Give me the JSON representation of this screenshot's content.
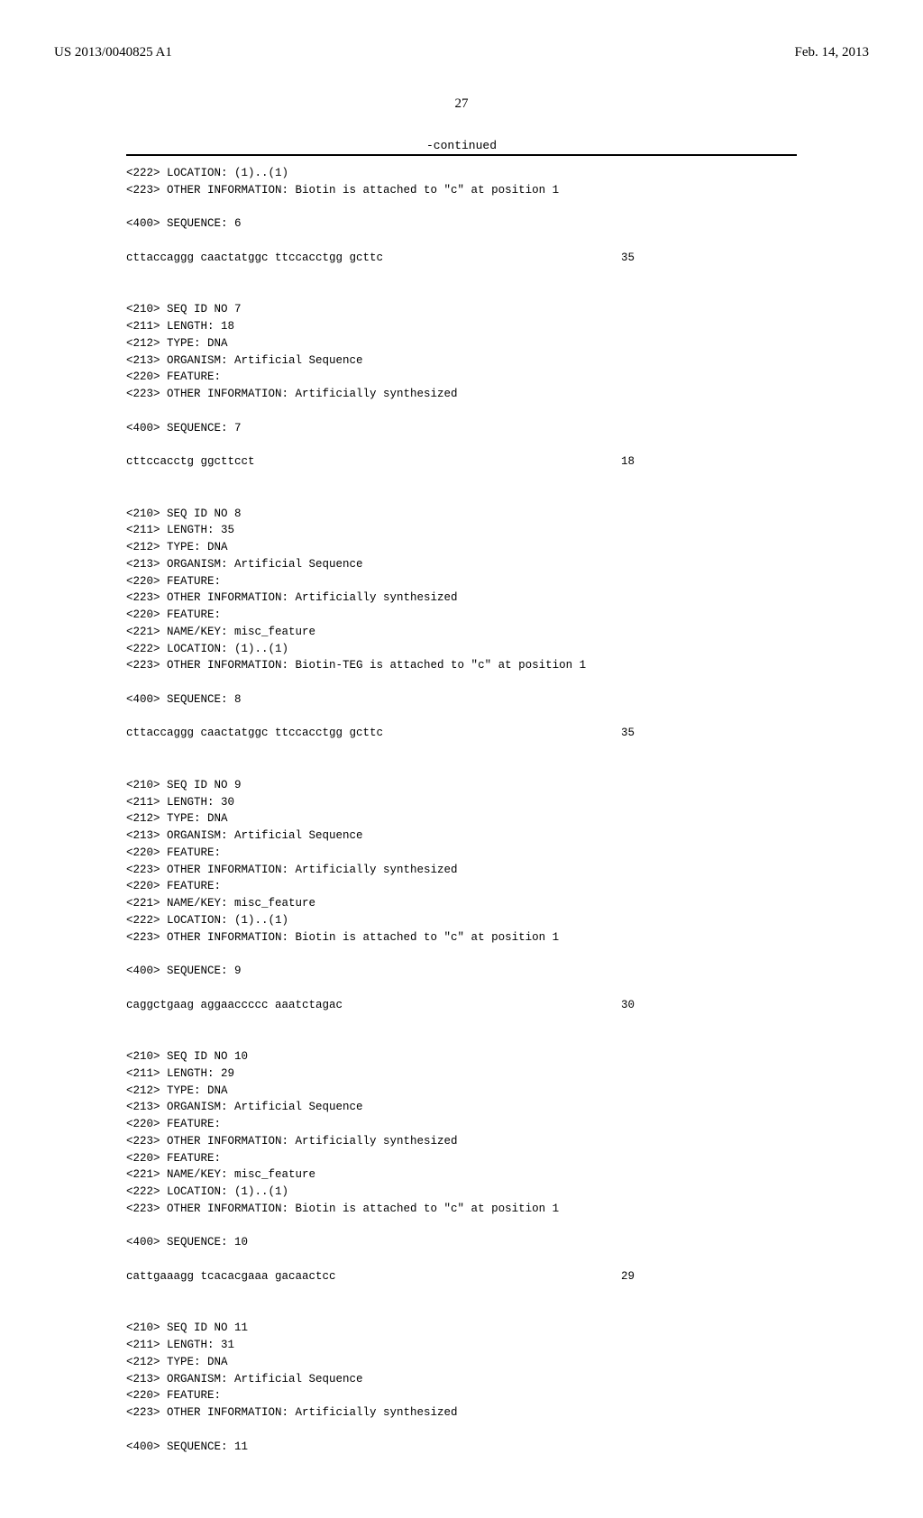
{
  "header": {
    "left": "US 2013/0040825 A1",
    "right": "Feb. 14, 2013"
  },
  "page_number": "27",
  "continued_label": "-continued",
  "blocks": [
    {
      "lines": [
        "<222> LOCATION: (1)..(1)",
        "<223> OTHER INFORMATION: Biotin is attached to \"c\" at position 1",
        "",
        "<400> SEQUENCE: 6"
      ],
      "sequence": "cttaccaggg caactatggc ttccacctgg gcttc",
      "seq_num": "35"
    },
    {
      "lines": [
        "<210> SEQ ID NO 7",
        "<211> LENGTH: 18",
        "<212> TYPE: DNA",
        "<213> ORGANISM: Artificial Sequence",
        "<220> FEATURE:",
        "<223> OTHER INFORMATION: Artificially synthesized",
        "",
        "<400> SEQUENCE: 7"
      ],
      "sequence": "cttccacctg ggcttcct",
      "seq_num": "18"
    },
    {
      "lines": [
        "<210> SEQ ID NO 8",
        "<211> LENGTH: 35",
        "<212> TYPE: DNA",
        "<213> ORGANISM: Artificial Sequence",
        "<220> FEATURE:",
        "<223> OTHER INFORMATION: Artificially synthesized",
        "<220> FEATURE:",
        "<221> NAME/KEY: misc_feature",
        "<222> LOCATION: (1)..(1)",
        "<223> OTHER INFORMATION: Biotin-TEG is attached to \"c\" at position 1",
        "",
        "<400> SEQUENCE: 8"
      ],
      "sequence": "cttaccaggg caactatggc ttccacctgg gcttc",
      "seq_num": "35"
    },
    {
      "lines": [
        "<210> SEQ ID NO 9",
        "<211> LENGTH: 30",
        "<212> TYPE: DNA",
        "<213> ORGANISM: Artificial Sequence",
        "<220> FEATURE:",
        "<223> OTHER INFORMATION: Artificially synthesized",
        "<220> FEATURE:",
        "<221> NAME/KEY: misc_feature",
        "<222> LOCATION: (1)..(1)",
        "<223> OTHER INFORMATION: Biotin is attached to \"c\" at position 1",
        "",
        "<400> SEQUENCE: 9"
      ],
      "sequence": "caggctgaag aggaaccccc aaatctagac",
      "seq_num": "30"
    },
    {
      "lines": [
        "<210> SEQ ID NO 10",
        "<211> LENGTH: 29",
        "<212> TYPE: DNA",
        "<213> ORGANISM: Artificial Sequence",
        "<220> FEATURE:",
        "<223> OTHER INFORMATION: Artificially synthesized",
        "<220> FEATURE:",
        "<221> NAME/KEY: misc_feature",
        "<222> LOCATION: (1)..(1)",
        "<223> OTHER INFORMATION: Biotin is attached to \"c\" at position 1",
        "",
        "<400> SEQUENCE: 10"
      ],
      "sequence": "cattgaaagg tcacacgaaa gacaactcc",
      "seq_num": "29"
    },
    {
      "lines": [
        "<210> SEQ ID NO 11",
        "<211> LENGTH: 31",
        "<212> TYPE: DNA",
        "<213> ORGANISM: Artificial Sequence",
        "<220> FEATURE:",
        "<223> OTHER INFORMATION: Artificially synthesized",
        "",
        "<400> SEQUENCE: 11"
      ],
      "sequence": "",
      "seq_num": ""
    }
  ]
}
